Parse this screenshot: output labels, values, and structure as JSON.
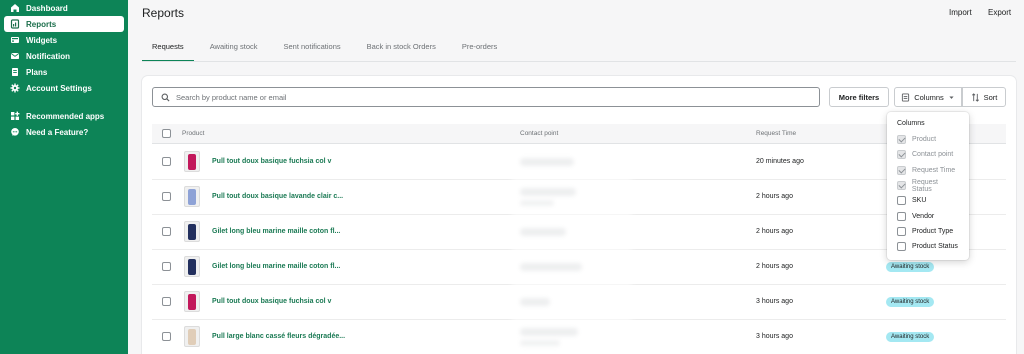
{
  "sidebar": {
    "items": [
      {
        "label": "Dashboard",
        "icon": "home-icon",
        "active": false
      },
      {
        "label": "Reports",
        "icon": "reports-icon",
        "active": true
      },
      {
        "label": "Widgets",
        "icon": "widgets-icon",
        "active": false
      },
      {
        "label": "Notification",
        "icon": "mail-icon",
        "active": false
      },
      {
        "label": "Plans",
        "icon": "plans-icon",
        "active": false
      },
      {
        "label": "Account Settings",
        "icon": "gear-icon",
        "active": false
      }
    ],
    "secondary": [
      {
        "label": "Recommended apps",
        "icon": "apps-icon"
      },
      {
        "label": "Need a Feature?",
        "icon": "chat-icon"
      }
    ]
  },
  "header": {
    "title": "Reports",
    "import_label": "Import",
    "export_label": "Export"
  },
  "tabs": [
    {
      "label": "Requests",
      "active": true
    },
    {
      "label": "Awaiting stock",
      "active": false
    },
    {
      "label": "Sent notifications",
      "active": false
    },
    {
      "label": "Back in stock Orders",
      "active": false
    },
    {
      "label": "Pre-orders",
      "active": false
    }
  ],
  "toolbar": {
    "search_placeholder": "Search by product name or email",
    "more_filters_label": "More filters",
    "columns_label": "Columns",
    "sort_label": "Sort"
  },
  "table": {
    "headers": {
      "product": "Product",
      "contact": "Contact point",
      "time": "Request Time"
    },
    "rows": [
      {
        "product": "Pull tout doux basique fuchsia col v",
        "time": "20 minutes ago",
        "status": "",
        "thumb": "#c2185b"
      },
      {
        "product": "Pull tout doux basique lavande clair c...",
        "time": "2 hours ago",
        "status": "",
        "thumb": "#8ea2d6"
      },
      {
        "product": "Gilet long bleu marine maille coton fl...",
        "time": "2 hours ago",
        "status": "",
        "thumb": "#23305e"
      },
      {
        "product": "Gilet long bleu marine maille coton fl...",
        "time": "2 hours ago",
        "status": "Awaiting stock",
        "thumb": "#23305e"
      },
      {
        "product": "Pull tout doux basique fuchsia col v",
        "time": "3 hours ago",
        "status": "Awaiting stock",
        "thumb": "#c2185b"
      },
      {
        "product": "Pull large blanc cassé fleurs dégradée...",
        "time": "3 hours ago",
        "status": "Awaiting stock",
        "thumb": "#e0cdb8"
      }
    ]
  },
  "columns_menu": {
    "title": "Columns",
    "options": [
      {
        "label": "Product",
        "checked": true,
        "disabled": true
      },
      {
        "label": "Contact point",
        "checked": true,
        "disabled": true
      },
      {
        "label": "Request Time",
        "checked": true,
        "disabled": true
      },
      {
        "label": "Request Status",
        "checked": true,
        "disabled": true
      },
      {
        "label": "SKU",
        "checked": false,
        "disabled": false
      },
      {
        "label": "Vendor",
        "checked": false,
        "disabled": false
      },
      {
        "label": "Product Type",
        "checked": false,
        "disabled": false
      },
      {
        "label": "Product Status",
        "checked": false,
        "disabled": false
      }
    ]
  },
  "colors": {
    "sidebar": "#0d8457",
    "link": "#1b7a54",
    "badge": "#a4e8f2"
  }
}
